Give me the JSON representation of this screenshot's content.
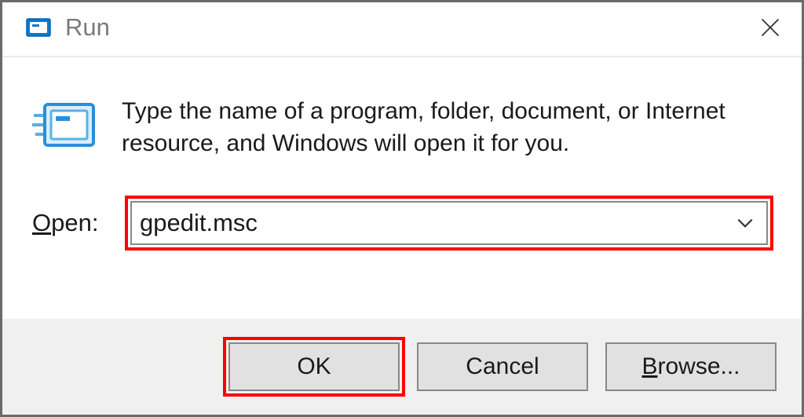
{
  "titlebar": {
    "title": "Run"
  },
  "body": {
    "description": "Type the name of a program, folder, document, or Internet resource, and Windows will open it for you.",
    "open_label_accel": "O",
    "open_label_rest": "pen:",
    "input_value": "gpedit.msc"
  },
  "buttons": {
    "ok": "OK",
    "cancel": "Cancel",
    "browse_accel": "B",
    "browse_rest": "rowse..."
  },
  "icons": {
    "title_icon": "run-icon-small",
    "body_icon": "run-icon-large",
    "close": "close-icon",
    "chevron": "chevron-down-icon"
  }
}
